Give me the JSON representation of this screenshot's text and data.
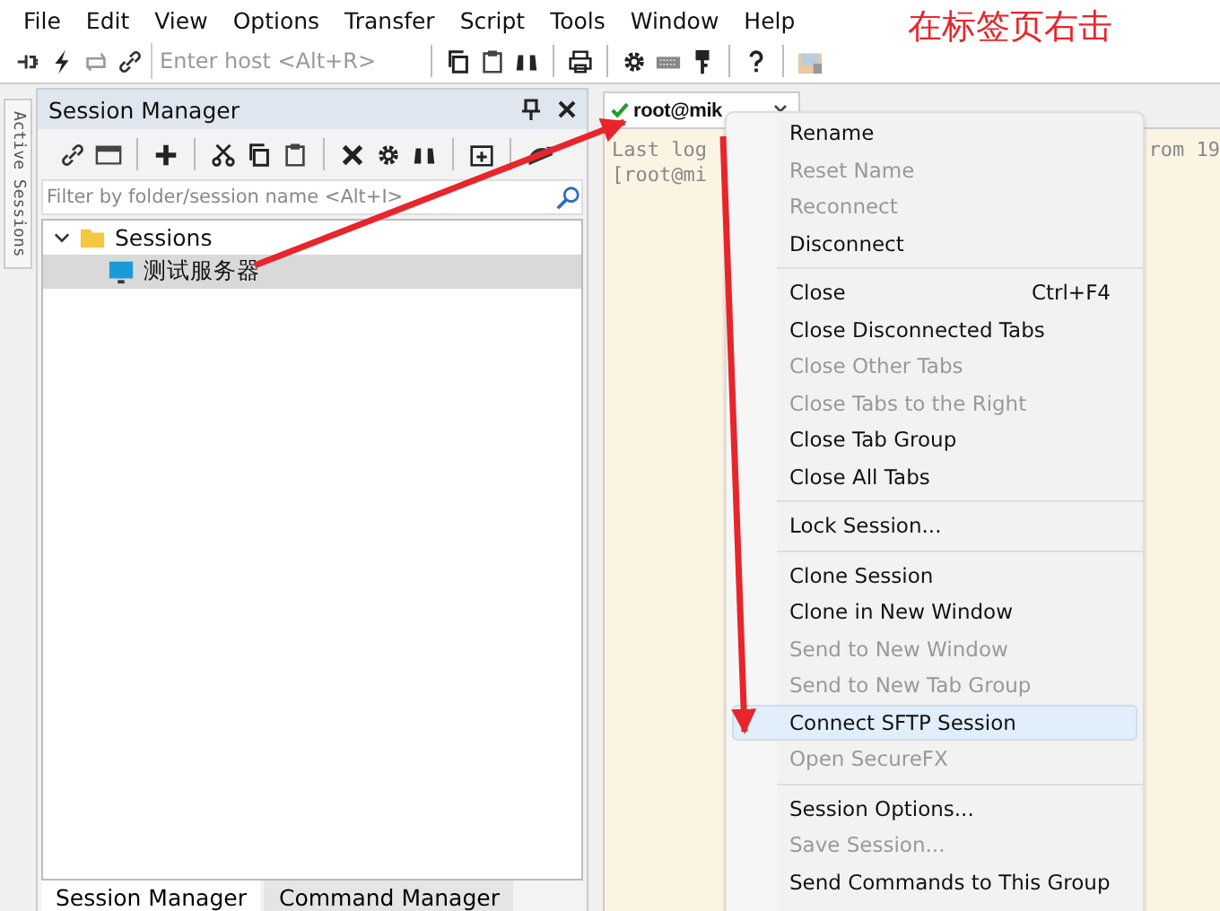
{
  "menu_bar": [
    "File",
    "Edit",
    "View",
    "Options",
    "Transfer",
    "Script",
    "Tools",
    "Window",
    "Help"
  ],
  "toolbar": {
    "host_field": {
      "placeholder": "Enter host <Alt+R>"
    }
  },
  "annotation": "在标签页右击",
  "side_strip": {
    "label": "Active Sessions"
  },
  "session_manager": {
    "title": "Session Manager",
    "filter": {
      "placeholder": "Filter by folder/session name <Alt+I>"
    },
    "tree": [
      {
        "label": "Sessions",
        "kind": "folder",
        "expanded": true,
        "selected": false,
        "children": [
          {
            "label": "测试服务器",
            "kind": "session",
            "selected": true
          }
        ]
      }
    ],
    "bottom_tabs": [
      {
        "label": "Session Manager",
        "selected": true
      },
      {
        "label": "Command Manager",
        "selected": false
      }
    ]
  },
  "session_tab": {
    "title": "root@mik",
    "connected": true
  },
  "terminal": {
    "lines": [
      {
        "left": "Last log",
        "right": "rom 19"
      },
      {
        "left": "[root@mi"
      }
    ]
  },
  "context_menu": [
    {
      "kind": "item",
      "label": "Rename",
      "disabled": false,
      "selected": false
    },
    {
      "kind": "item",
      "label": "Reset Name",
      "disabled": true,
      "selected": false
    },
    {
      "kind": "item",
      "label": "Reconnect",
      "disabled": true,
      "selected": false
    },
    {
      "kind": "item",
      "label": "Disconnect",
      "disabled": false,
      "selected": false
    },
    {
      "kind": "separator"
    },
    {
      "kind": "item",
      "label": "Close",
      "shortcut": "Ctrl+F4",
      "disabled": false,
      "selected": false
    },
    {
      "kind": "item",
      "label": "Close Disconnected Tabs",
      "disabled": false,
      "selected": false
    },
    {
      "kind": "item",
      "label": "Close Other Tabs",
      "disabled": true,
      "selected": false
    },
    {
      "kind": "item",
      "label": "Close Tabs to the Right",
      "disabled": true,
      "selected": false
    },
    {
      "kind": "item",
      "label": "Close Tab Group",
      "disabled": false,
      "selected": false
    },
    {
      "kind": "item",
      "label": "Close All Tabs",
      "disabled": false,
      "selected": false
    },
    {
      "kind": "separator"
    },
    {
      "kind": "item",
      "label": "Lock Session...",
      "disabled": false,
      "selected": false
    },
    {
      "kind": "separator"
    },
    {
      "kind": "item",
      "label": "Clone Session",
      "disabled": false,
      "selected": false
    },
    {
      "kind": "item",
      "label": "Clone in New Window",
      "disabled": false,
      "selected": false
    },
    {
      "kind": "item",
      "label": "Send to New Window",
      "disabled": true,
      "selected": false
    },
    {
      "kind": "item",
      "label": "Send to New Tab Group",
      "disabled": true,
      "selected": false
    },
    {
      "kind": "item",
      "label": "Connect SFTP Session",
      "disabled": false,
      "selected": true
    },
    {
      "kind": "item",
      "label": "Open SecureFX",
      "disabled": true,
      "selected": false
    },
    {
      "kind": "separator"
    },
    {
      "kind": "item",
      "label": "Session Options...",
      "disabled": false,
      "selected": false
    },
    {
      "kind": "item",
      "label": "Save Session...",
      "disabled": true,
      "selected": false
    },
    {
      "kind": "item",
      "label": "Send Commands to This Group",
      "disabled": false,
      "selected": false
    }
  ]
}
